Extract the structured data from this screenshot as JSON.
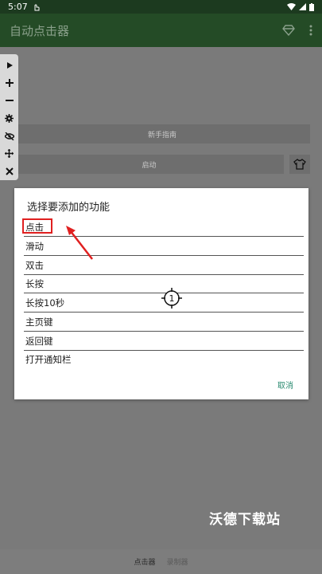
{
  "status_bar": {
    "time": "5:07"
  },
  "app_bar": {
    "title": "自动点击器"
  },
  "buttons": {
    "guide": "新手指南",
    "start": "启动"
  },
  "toolbar": {
    "items": [
      "play-icon",
      "plus-icon",
      "minus-icon",
      "gear-icon",
      "eye-off-icon",
      "move-icon",
      "close-icon"
    ]
  },
  "dialog": {
    "title": "选择要添加的功能",
    "options": [
      "点击",
      "滑动",
      "双击",
      "长按",
      "长按10秒",
      "主页键",
      "返回键",
      "打开通知栏"
    ],
    "cancel": "取消"
  },
  "crosshair": {
    "label": "1"
  },
  "watermark": "沃德下载站",
  "bottom_nav": {
    "tabs": [
      "点击器",
      "录制器"
    ]
  },
  "colors": {
    "accent": "#244b26",
    "highlight": "#e02020",
    "cancel": "#2a8a70"
  }
}
